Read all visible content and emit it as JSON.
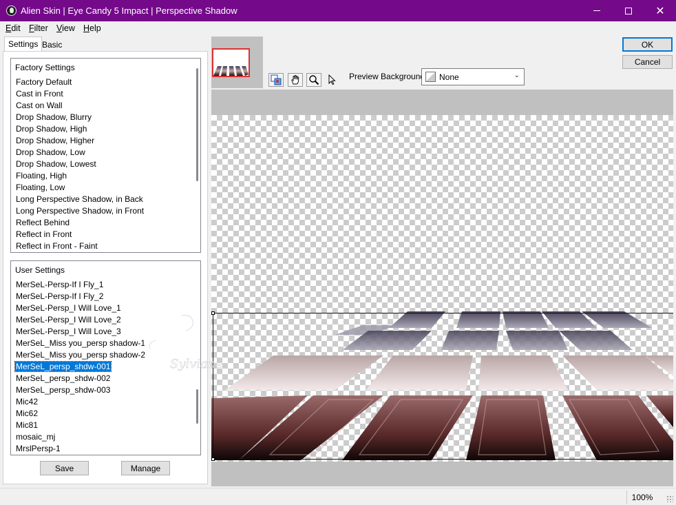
{
  "window": {
    "title": "Alien Skin | Eye Candy 5 Impact | Perspective Shadow",
    "minimize_glyph": "—",
    "maximize_glyph": "☐",
    "close_glyph": "✕"
  },
  "menu": [
    "Edit",
    "Filter",
    "View",
    "Help"
  ],
  "tabs": [
    "Settings",
    "Basic"
  ],
  "factory_settings": {
    "header": "Factory Settings",
    "items": [
      "Factory Default",
      "Cast in Front",
      "Cast on Wall",
      "Drop Shadow, Blurry",
      "Drop Shadow, High",
      "Drop Shadow, Higher",
      "Drop Shadow, Low",
      "Drop Shadow, Lowest",
      "Floating, High",
      "Floating, Low",
      "Long Perspective Shadow, in Back",
      "Long Perspective Shadow, in Front",
      "Reflect Behind",
      "Reflect in Front",
      "Reflect in Front - Faint"
    ]
  },
  "user_settings": {
    "header": "User Settings",
    "selected_index": 7,
    "items": [
      "MerSeL-Persp-If I Fly_1",
      "MerSeL-Persp-If I Fly_2",
      "MerSeL-Persp_I Will Love_1",
      "MerSeL-Persp_I Will Love_2",
      "MerSeL-Persp_I Will Love_3",
      "MerSeL_Miss you_persp shadow-1",
      "MerSeL_Miss you_persp shadow-2",
      "MerSeL_persp_shdw-001",
      "MerSeL_persp_shdw-002",
      "MerSeL_persp_shdw-003",
      "Mic42",
      "Mic62",
      "Mic81",
      "mosaic_mj",
      "MrslPersp-1"
    ]
  },
  "buttons": {
    "save": "Save",
    "manage": "Manage",
    "ok": "OK",
    "cancel": "Cancel"
  },
  "preview_background": {
    "label": "Preview Background:",
    "value": "None"
  },
  "tools": [
    "preview-toggle-icon",
    "hand-icon",
    "zoom-icon",
    "arrow-pointer-icon"
  ],
  "watermark_text": "Sylviane",
  "status": {
    "zoom": "100%"
  },
  "colors": {
    "titlebar": "#74098a",
    "selection": "#0078d7",
    "tile_top": "#3a3c52",
    "tile_mid": "#c7a9a9",
    "tile_bottom": "#1a0d0d"
  }
}
